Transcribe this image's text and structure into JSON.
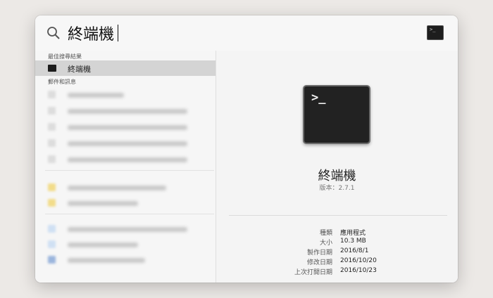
{
  "search": {
    "query": "終端機"
  },
  "sections": {
    "top_hit_header": "最佳搜尋結果",
    "mail_header": "郵件和訊息"
  },
  "top_hit": {
    "label": "終端機",
    "icon": "terminal-icon"
  },
  "preview": {
    "app_name": "終端機",
    "version": "版本：2.7.1",
    "terminal_prompt": ">_",
    "details": [
      {
        "key": "種類",
        "value": "應用程式"
      },
      {
        "key": "大小",
        "value": "10.3 MB"
      },
      {
        "key": "製作日期",
        "value": "2016/8/1"
      },
      {
        "key": "修改日期",
        "value": "2016/10/20"
      },
      {
        "key": "上次打開日期",
        "value": "2016/10/23"
      }
    ]
  }
}
